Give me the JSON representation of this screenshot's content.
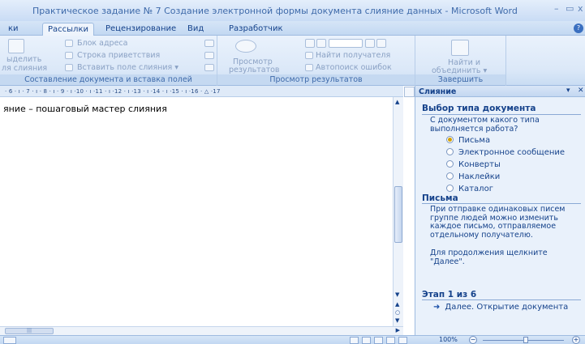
{
  "window": {
    "title": "Практическое задание № 7 Создание электронной формы документа слияние данных - Microsoft Word",
    "minimize": "–",
    "maximize": "▭",
    "close": "x"
  },
  "tabs": [
    {
      "label": "ки",
      "active": false
    },
    {
      "label": "Рассылки",
      "active": true
    },
    {
      "label": "Рецензирование",
      "active": false
    },
    {
      "label": "Вид",
      "active": false
    },
    {
      "label": "Разработчик",
      "active": false
    }
  ],
  "ribbon": {
    "group_compose": {
      "label": "Составление документа и вставка полей",
      "highlight_line1": "ыделить",
      "highlight_line2": "ля слияния",
      "address_block": "Блок адреса",
      "greeting_line": "Строка приветствия",
      "insert_merge_field": "Вставить поле слияния ▾"
    },
    "group_preview": {
      "label": "Просмотр результатов",
      "preview_line1": "Просмотр",
      "preview_line2": "результатов",
      "find_recipient": "Найти получателя",
      "auto_check": "Автопоиск ошибок"
    },
    "group_finish": {
      "label": "Завершить",
      "finish_line1": "Найти и",
      "finish_line2": "объединить ▾"
    }
  },
  "ruler": {
    "text": "· 6 · ı · 7 · ı · 8 · ı · 9 · ı ·10 · ı ·11 · ı ·12 · ı ·13 · ı ·14 · ı ·15 · ı ·16 · △ ·17"
  },
  "document": {
    "text": "яние – пошаговый мастер слияния"
  },
  "task_pane": {
    "title": "Слияние",
    "section1_title": "Выбор типа документа",
    "section1_question": "С документом какого типа выполняется работа?",
    "options": [
      {
        "label": "Письма",
        "selected": true
      },
      {
        "label": "Электронное сообщение",
        "selected": false
      },
      {
        "label": "Конверты",
        "selected": false
      },
      {
        "label": "Наклейки",
        "selected": false
      },
      {
        "label": "Каталог",
        "selected": false
      }
    ],
    "section2_title": "Письма",
    "section2_text": "При отправке одинаковых писем группе людей можно изменить каждое письмо, отправляемое отдельному получателю.",
    "section2_hint": "Для продолжения щелкните \"Далее\".",
    "step_label": "Этап 1 из 6",
    "next_link": "Далее. Открытие документа"
  },
  "status_bar": {
    "zoom": "100%"
  },
  "colors": {
    "ribbon_text": "#15428b",
    "selected_radio": "#d4a000"
  }
}
